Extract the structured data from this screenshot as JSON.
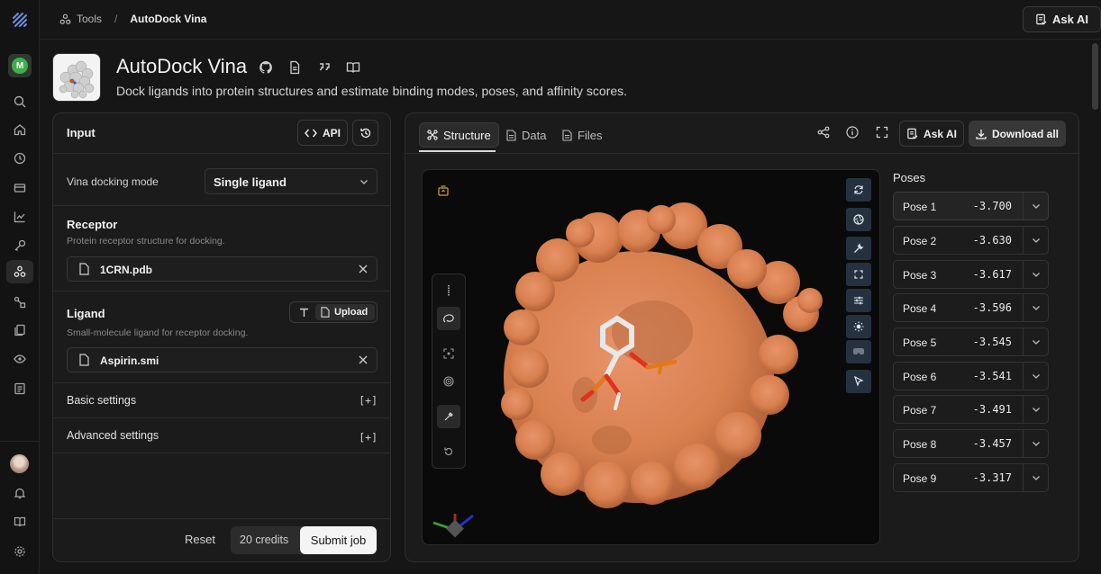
{
  "breadcrumb": {
    "root": "Tools",
    "separator": "/",
    "current": "AutoDock Vina"
  },
  "topbar": {
    "ask_ai": "Ask AI"
  },
  "rail": {
    "avatar_initial": "M"
  },
  "tool": {
    "title": "AutoDock Vina",
    "description": "Dock ligands into protein structures and estimate binding modes, poses, and affinity scores."
  },
  "input_panel": {
    "header": "Input",
    "api_label": "API",
    "mode_label": "Vina docking mode",
    "mode_value": "Single ligand",
    "receptor": {
      "title": "Receptor",
      "hint": "Protein receptor structure for docking.",
      "file": "1CRN.pdb"
    },
    "ligand": {
      "title": "Ligand",
      "hint": "Small-molecule ligand for receptor docking.",
      "upload": "Upload",
      "file": "Aspirin.smi"
    },
    "basic_settings": "Basic settings",
    "advanced_settings": "Advanced settings",
    "expand_marker": "[+]",
    "reset": "Reset",
    "credits": "20 credits",
    "submit": "Submit job"
  },
  "result_panel": {
    "tabs": [
      "Structure",
      "Data",
      "Files"
    ],
    "ask_ai": "Ask AI",
    "download_all": "Download all",
    "poses_title": "Poses",
    "poses": [
      {
        "name": "Pose 1",
        "score": "-3.700"
      },
      {
        "name": "Pose 2",
        "score": "-3.630"
      },
      {
        "name": "Pose 3",
        "score": "-3.617"
      },
      {
        "name": "Pose 4",
        "score": "-3.596"
      },
      {
        "name": "Pose 5",
        "score": "-3.545"
      },
      {
        "name": "Pose 6",
        "score": "-3.541"
      },
      {
        "name": "Pose 7",
        "score": "-3.491"
      },
      {
        "name": "Pose 8",
        "score": "-3.457"
      },
      {
        "name": "Pose 9",
        "score": "-3.317"
      }
    ]
  },
  "colors": {
    "surface": "#d9804f",
    "ligand_carbon": "#e8e8e8",
    "ligand_oxygen": "#e0301e",
    "ligand_highlight": "#e07a1a",
    "viewer_tool_bg": "#25313f"
  }
}
